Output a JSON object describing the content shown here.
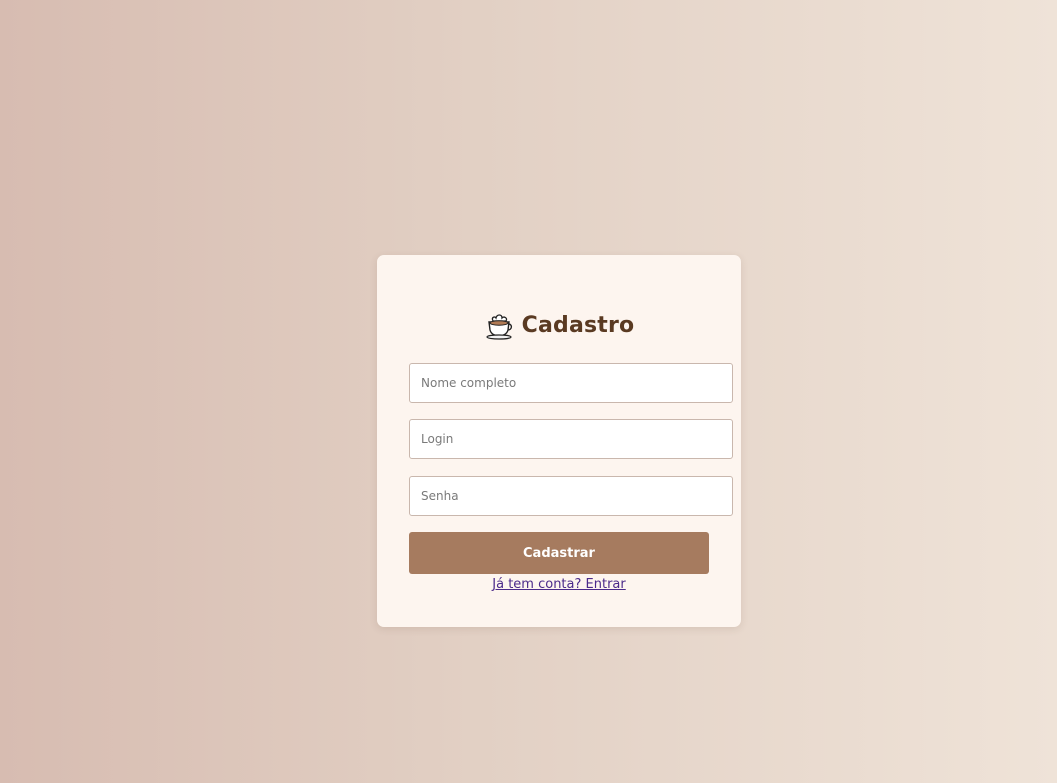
{
  "register_card": {
    "icon": "coffee-cup-icon",
    "title": "Cadastro",
    "fields": {
      "full_name_placeholder": "Nome completo",
      "login_placeholder": "Login",
      "password_placeholder": "Senha"
    },
    "submit_label": "Cadastrar",
    "login_link": "Já tem conta? Entrar"
  },
  "colors": {
    "background_left": "#d7bcb1",
    "background_right": "#efe3d8",
    "card_background": "#fdf5ef",
    "title_color": "#5a3a22",
    "button_color": "#a67b5f",
    "link_color": "#4b2a8a"
  }
}
